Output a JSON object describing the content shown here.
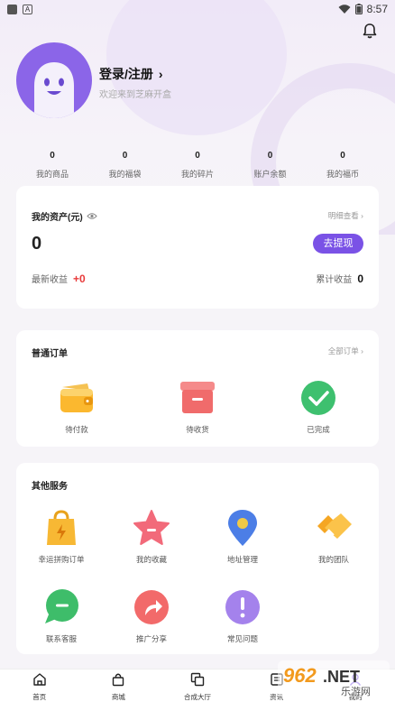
{
  "status_bar": {
    "time": "8:57",
    "battery_icon": "battery-icon",
    "wifi_icon": "wifi-icon"
  },
  "profile": {
    "login_label": "登录/注册",
    "login_chevron": "›",
    "subtitle": "欢迎来到芝麻开盒"
  },
  "stats": [
    {
      "value": "0",
      "label": "我的商品"
    },
    {
      "value": "0",
      "label": "我的福袋"
    },
    {
      "value": "0",
      "label": "我的碎片"
    },
    {
      "value": "0",
      "label": "账户余额"
    },
    {
      "value": "0",
      "label": "我的福币"
    }
  ],
  "assets": {
    "title": "我的资产(元)",
    "detail_link": "明细查看 ›",
    "amount": "0",
    "withdraw_button": "去提现",
    "recent_label": "最新收益",
    "recent_value": "+0",
    "total_label": "累计收益",
    "total_value": "0"
  },
  "orders": {
    "title": "普通订单",
    "all_link": "全部订单 ›",
    "items": [
      {
        "label": "待付款",
        "icon": "wallet-icon"
      },
      {
        "label": "待收货",
        "icon": "box-icon"
      },
      {
        "label": "已完成",
        "icon": "check-icon"
      }
    ]
  },
  "services": {
    "title": "其他服务",
    "items": [
      {
        "label": "幸运拼购订单",
        "icon": "lucky-bag-icon"
      },
      {
        "label": "我的收藏",
        "icon": "star-icon"
      },
      {
        "label": "地址管理",
        "icon": "location-pin-icon"
      },
      {
        "label": "我的团队",
        "icon": "handshake-icon"
      },
      {
        "label": "联系客服",
        "icon": "chat-icon"
      },
      {
        "label": "推广分享",
        "icon": "share-icon"
      },
      {
        "label": "常见问题",
        "icon": "exclamation-icon"
      }
    ]
  },
  "bottom_nav": [
    {
      "label": "首页",
      "icon": "home-icon"
    },
    {
      "label": "商城",
      "icon": "shopping-bag-icon"
    },
    {
      "label": "合成大厅",
      "icon": "merge-icon"
    },
    {
      "label": "资讯",
      "icon": "news-icon"
    },
    {
      "label": "我的",
      "icon": "user-icon"
    }
  ],
  "watermark": {
    "brand": "962.NET",
    "sub": "乐游网"
  },
  "colors": {
    "accent": "#7a52e6",
    "red": "#e83a3a"
  }
}
